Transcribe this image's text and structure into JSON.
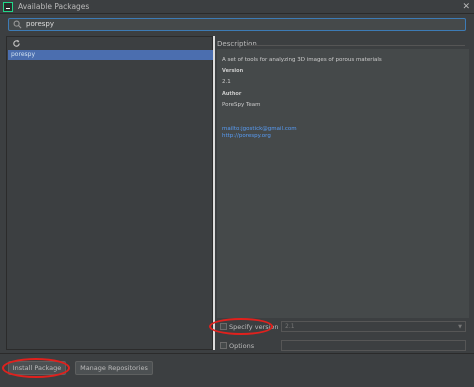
{
  "window": {
    "title": "Available Packages",
    "close_glyph": "✕"
  },
  "search": {
    "value": "porespy"
  },
  "packages": {
    "items": [
      {
        "name": "porespy",
        "selected": true
      }
    ]
  },
  "description": {
    "label": "Description",
    "summary": "A set of tools for analyzing 3D images of porous materials",
    "version_heading": "Version",
    "version": "2.1",
    "author_heading": "Author",
    "author": "PoreSpy Team",
    "links": [
      "mailto:jgostick@gmail.com",
      "http://porespy.org"
    ]
  },
  "options": {
    "specify_version_label": "Specify version",
    "specify_version_value": "2.1",
    "options_label": "Options",
    "options_value": ""
  },
  "footer": {
    "install_label": "Install Package",
    "manage_label": "Manage Repositories"
  },
  "icons": {
    "app": "pycharm-icon",
    "search": "search-icon",
    "refresh": "refresh-icon",
    "dropdown": "chevron-down-icon",
    "close": "close-icon"
  },
  "colors": {
    "background": "#3c3f41",
    "selection": "#4b6eaf",
    "link": "#589df6",
    "annotation": "#e0211d",
    "search_border": "#3d7bb5"
  }
}
